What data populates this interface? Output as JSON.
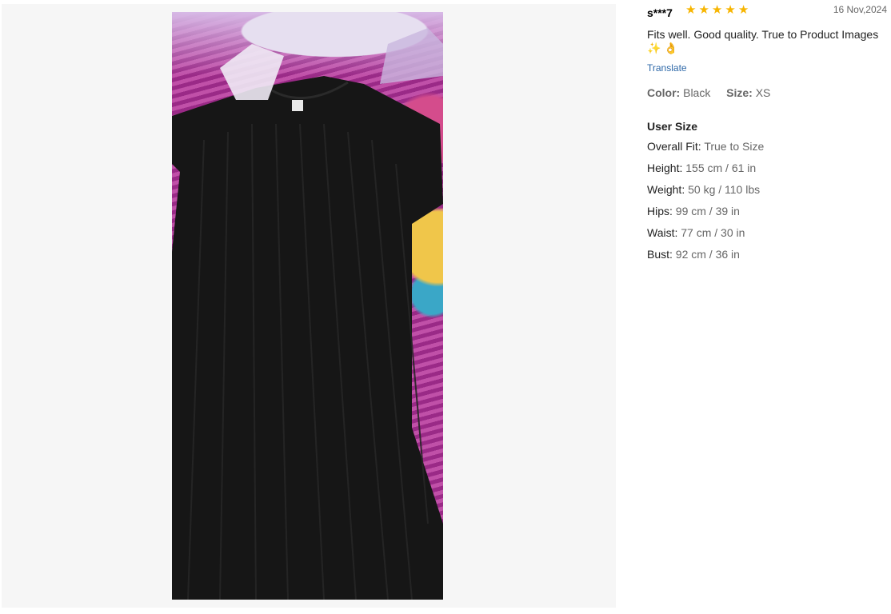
{
  "review": {
    "reviewer": "s***7",
    "rating": 5,
    "stars": [
      "★",
      "★",
      "★",
      "★",
      "★"
    ],
    "date": "16 Nov,2024",
    "text": "Fits well. Good quality. True to Product Images ✨ 👌",
    "translate_label": "Translate",
    "color_key": "Color:",
    "color_value": "Black",
    "size_key": "Size:",
    "size_value": "XS"
  },
  "user_size": {
    "title": "User Size",
    "rows": [
      {
        "key": "Overall Fit:",
        "value": "True to Size"
      },
      {
        "key": "Height:",
        "value": "155 cm / 61 in"
      },
      {
        "key": "Weight:",
        "value": "50 kg / 110 lbs"
      },
      {
        "key": "Hips:",
        "value": "99 cm / 39 in"
      },
      {
        "key": "Waist:",
        "value": "77 cm / 30 in"
      },
      {
        "key": "Bust:",
        "value": "92 cm / 36 in"
      }
    ]
  },
  "colors": {
    "star": "#f7b500",
    "link": "#2d68a8",
    "panel_bg": "#f6f6f6"
  }
}
